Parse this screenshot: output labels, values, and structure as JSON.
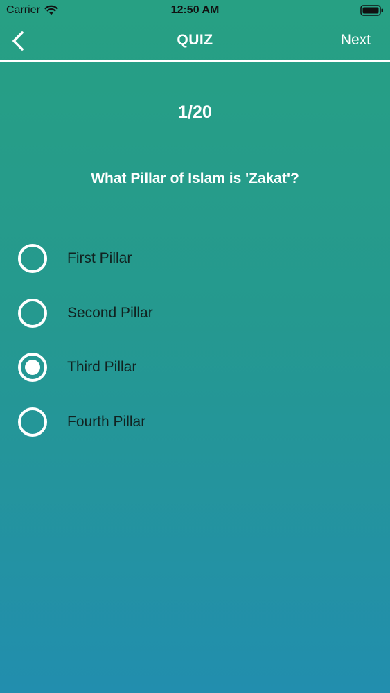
{
  "status_bar": {
    "carrier": "Carrier",
    "time": "12:50 AM"
  },
  "nav": {
    "title": "QUIZ",
    "next_label": "Next"
  },
  "quiz": {
    "progress": "1/20",
    "question": "What Pillar of Islam is 'Zakat'?",
    "options": [
      {
        "label": "First Pillar",
        "selected": false
      },
      {
        "label": "Second Pillar",
        "selected": false
      },
      {
        "label": "Third Pillar",
        "selected": true
      },
      {
        "label": "Fourth Pillar",
        "selected": false
      }
    ]
  },
  "colors": {
    "gradient_top": "#27A083",
    "gradient_bottom": "#228EAE",
    "text_light": "#FFFFFF",
    "option_text": "#112220"
  }
}
